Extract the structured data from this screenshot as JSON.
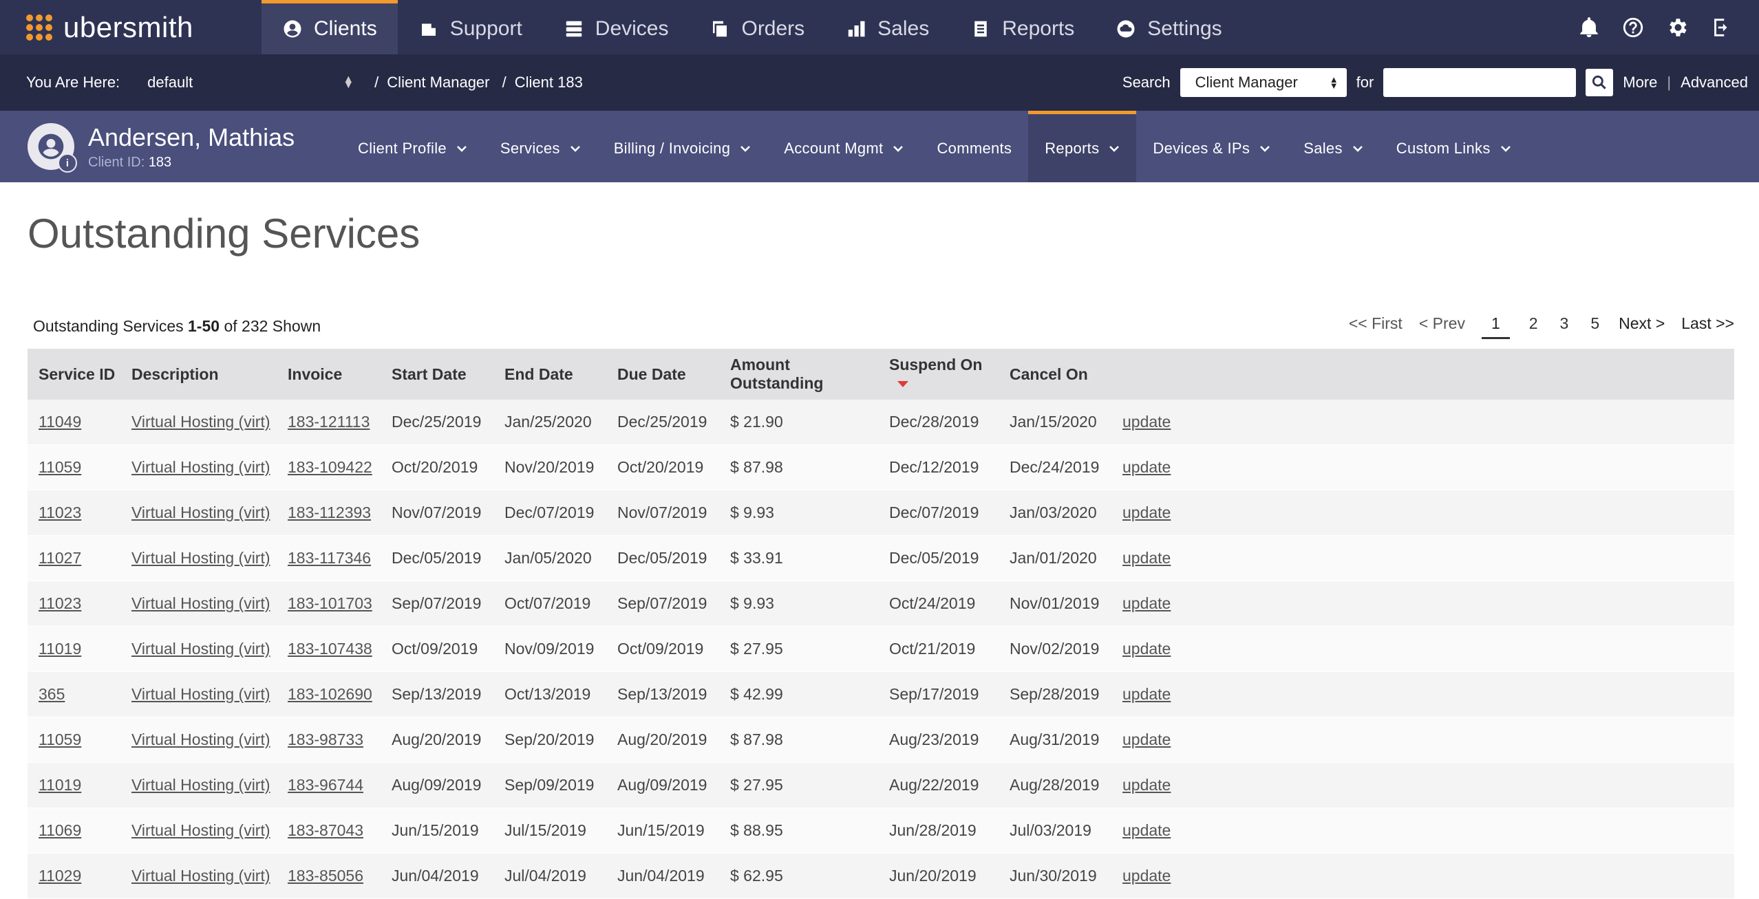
{
  "app": {
    "logo_text": "ubersmith"
  },
  "topnav": {
    "items": [
      {
        "label": "Clients",
        "icon": "user-circle-icon",
        "active": true
      },
      {
        "label": "Support",
        "icon": "ticket-icon"
      },
      {
        "label": "Devices",
        "icon": "server-icon"
      },
      {
        "label": "Orders",
        "icon": "copy-icon"
      },
      {
        "label": "Sales",
        "icon": "bar-chart-icon"
      },
      {
        "label": "Reports",
        "icon": "clipboard-icon"
      },
      {
        "label": "Settings",
        "icon": "cloud-icon"
      }
    ],
    "right_icons": [
      "bell-icon",
      "help-icon",
      "gear-icon",
      "logout-icon"
    ]
  },
  "crumbbar": {
    "label": "You Are Here:",
    "selected_brand": "default",
    "path": [
      "Client Manager",
      "Client 183"
    ],
    "search_label": "Search",
    "search_scope": "Client Manager",
    "for_label": "for",
    "search_value": "",
    "more_label": "More",
    "advanced_label": "Advanced"
  },
  "client": {
    "name": "Andersen, Mathias",
    "id_label": "Client ID:",
    "id": "183",
    "nav": [
      {
        "label": "Client Profile",
        "dropdown": true
      },
      {
        "label": "Services",
        "dropdown": true
      },
      {
        "label": "Billing / Invoicing",
        "dropdown": true
      },
      {
        "label": "Account Mgmt",
        "dropdown": true
      },
      {
        "label": "Comments",
        "dropdown": false
      },
      {
        "label": "Reports",
        "dropdown": true,
        "active": true
      },
      {
        "label": "Devices & IPs",
        "dropdown": true
      },
      {
        "label": "Sales",
        "dropdown": true
      },
      {
        "label": "Custom Links",
        "dropdown": true
      }
    ]
  },
  "main": {
    "title": "Outstanding Services",
    "summary_prefix": "Outstanding Services",
    "summary_range": "1-50",
    "summary_suffix": "of 232 Shown",
    "pager": {
      "first": "<< First",
      "prev": "< Prev",
      "pages": [
        "1",
        "2",
        "3",
        "5"
      ],
      "current": "1",
      "next": "Next >",
      "last": "Last >>"
    },
    "columns": [
      "Service ID",
      "Description",
      "Invoice",
      "Start Date",
      "End Date",
      "Due Date",
      "Amount Outstanding",
      "Suspend On",
      "Cancel On",
      ""
    ],
    "sorted_column": "Suspend On",
    "rows": [
      [
        "11049",
        "Virtual Hosting (virt)",
        "183-121113",
        "Dec/25/2019",
        "Jan/25/2020",
        "Dec/25/2019",
        "$ 21.90",
        "Dec/28/2019",
        "Jan/15/2020",
        "update"
      ],
      [
        "11059",
        "Virtual Hosting (virt)",
        "183-109422",
        "Oct/20/2019",
        "Nov/20/2019",
        "Oct/20/2019",
        "$ 87.98",
        "Dec/12/2019",
        "Dec/24/2019",
        "update"
      ],
      [
        "11023",
        "Virtual Hosting (virt)",
        "183-112393",
        "Nov/07/2019",
        "Dec/07/2019",
        "Nov/07/2019",
        "$ 9.93",
        "Dec/07/2019",
        "Jan/03/2020",
        "update"
      ],
      [
        "11027",
        "Virtual Hosting (virt)",
        "183-117346",
        "Dec/05/2019",
        "Jan/05/2020",
        "Dec/05/2019",
        "$ 33.91",
        "Dec/05/2019",
        "Jan/01/2020",
        "update"
      ],
      [
        "11023",
        "Virtual Hosting (virt)",
        "183-101703",
        "Sep/07/2019",
        "Oct/07/2019",
        "Sep/07/2019",
        "$ 9.93",
        "Oct/24/2019",
        "Nov/01/2019",
        "update"
      ],
      [
        "11019",
        "Virtual Hosting (virt)",
        "183-107438",
        "Oct/09/2019",
        "Nov/09/2019",
        "Oct/09/2019",
        "$ 27.95",
        "Oct/21/2019",
        "Nov/02/2019",
        "update"
      ],
      [
        "365",
        "Virtual Hosting (virt)",
        "183-102690",
        "Sep/13/2019",
        "Oct/13/2019",
        "Sep/13/2019",
        "$ 42.99",
        "Sep/17/2019",
        "Sep/28/2019",
        "update"
      ],
      [
        "11059",
        "Virtual Hosting (virt)",
        "183-98733",
        "Aug/20/2019",
        "Sep/20/2019",
        "Aug/20/2019",
        "$ 87.98",
        "Aug/23/2019",
        "Aug/31/2019",
        "update"
      ],
      [
        "11019",
        "Virtual Hosting (virt)",
        "183-96744",
        "Aug/09/2019",
        "Sep/09/2019",
        "Aug/09/2019",
        "$ 27.95",
        "Aug/22/2019",
        "Aug/28/2019",
        "update"
      ],
      [
        "11069",
        "Virtual Hosting (virt)",
        "183-87043",
        "Jun/15/2019",
        "Jul/15/2019",
        "Jun/15/2019",
        "$ 88.95",
        "Jun/28/2019",
        "Jul/03/2019",
        "update"
      ],
      [
        "11029",
        "Virtual Hosting (virt)",
        "183-85056",
        "Jun/04/2019",
        "Jul/04/2019",
        "Jun/04/2019",
        "$ 62.95",
        "Jun/20/2019",
        "Jun/30/2019",
        "update"
      ]
    ]
  }
}
